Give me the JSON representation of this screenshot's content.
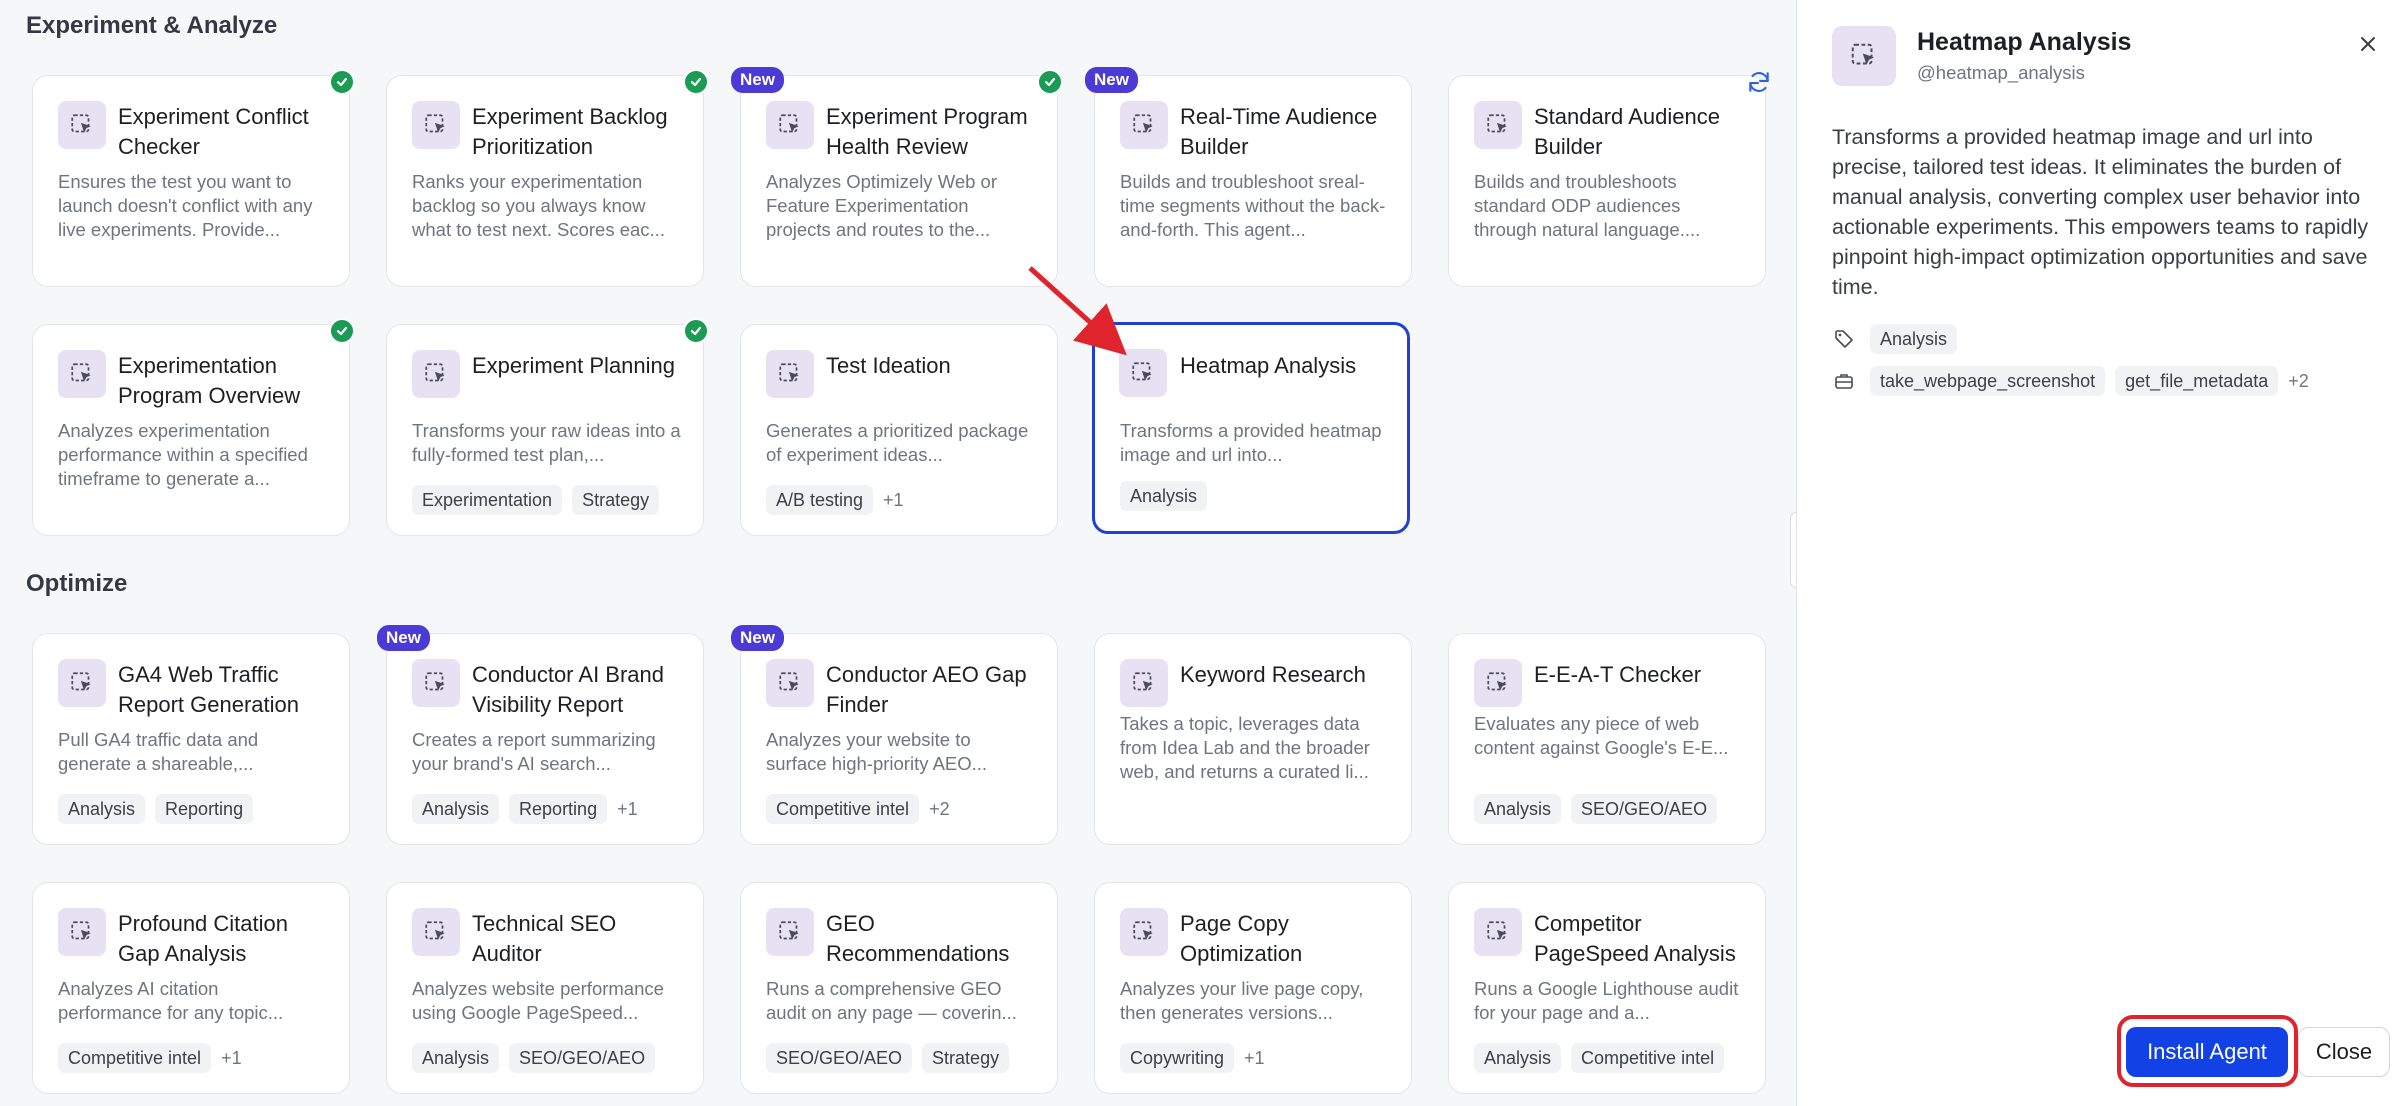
{
  "sections": {
    "experiment": "Experiment & Analyze",
    "optimize": "Optimize"
  },
  "cards": {
    "conflict": {
      "title": "Experiment Conflict Checker",
      "desc": "Ensures the test you want to launch doesn't conflict with any live experiments. Provide...",
      "badge": "check"
    },
    "backlog": {
      "title": "Experiment Backlog Prioritization",
      "desc": "Ranks your experimentation backlog so you always know what to test next. Scores eac...",
      "badge": "check"
    },
    "health": {
      "title": "Experiment Program Health Review",
      "desc": "Analyzes Optimizely Web or Feature Experimentation projects and routes to the...",
      "badge_new": "New",
      "badge": "check"
    },
    "realtime": {
      "title": "Real-Time Audience Builder",
      "desc": "Builds and troubleshoot sreal-time segments without the back-and-forth. This agent...",
      "badge_new": "New"
    },
    "standard": {
      "title": "Standard Audience Builder",
      "desc": "Builds and troubleshoots standard ODP audiences through natural language....",
      "badge": "refresh"
    },
    "overview": {
      "title": "Experimentation Program Overview",
      "desc": "Analyzes experimentation performance within a specified timeframe to generate a...",
      "badge": "check"
    },
    "planning": {
      "title": "Experiment Planning",
      "desc": "Transforms your raw ideas into a fully-formed test plan,...",
      "tags": [
        "Experimentation",
        "Strategy"
      ],
      "badge": "check"
    },
    "ideation": {
      "title": "Test Ideation",
      "desc": "Generates a prioritized package of experiment ideas...",
      "tags": [
        "A/B testing"
      ],
      "more": "+1"
    },
    "heatmap": {
      "title": "Heatmap Analysis",
      "desc": "Transforms a provided heatmap image and url into...",
      "tags": [
        "Analysis"
      ]
    },
    "ga4": {
      "title": "GA4 Web Traffic Report Generation",
      "desc": "Pull GA4 traffic data and generate a shareable,...",
      "tags": [
        "Analysis",
        "Reporting"
      ]
    },
    "brand": {
      "title": "Conductor AI Brand Visibility Report",
      "desc": "Creates a report summarizing your brand's AI search...",
      "tags": [
        "Analysis",
        "Reporting"
      ],
      "more": "+1",
      "badge_new": "New"
    },
    "aeo": {
      "title": "Conductor AEO Gap Finder",
      "desc": "Analyzes your website to surface high-priority AEO...",
      "tags": [
        "Competitive intel"
      ],
      "more": "+2",
      "badge_new": "New"
    },
    "keyword": {
      "title": "Keyword Research",
      "desc": "Takes a topic, leverages data from Idea Lab and the broader web, and returns a curated li..."
    },
    "eeat": {
      "title": "E-E-A-T Checker",
      "desc": "Evaluates any piece of web content against Google's E-E...",
      "tags": [
        "Analysis",
        "SEO/GEO/AEO"
      ]
    },
    "citation": {
      "title": "Profound Citation Gap Analysis",
      "desc": "Analyzes AI citation performance for any topic...",
      "tags": [
        "Competitive intel"
      ],
      "more": "+1"
    },
    "seo": {
      "title": "Technical SEO Auditor",
      "desc": "Analyzes website performance using Google PageSpeed...",
      "tags": [
        "Analysis",
        "SEO/GEO/AEO"
      ]
    },
    "geo": {
      "title": "GEO Recommendations",
      "desc": "Runs a comprehensive GEO audit on any page — coverin...",
      "tags": [
        "SEO/GEO/AEO",
        "Strategy"
      ]
    },
    "copy": {
      "title": "Page Copy Optimization",
      "desc": "Analyzes your live page copy, then generates versions...",
      "tags": [
        "Copywriting"
      ],
      "more": "+1"
    },
    "pagespeed": {
      "title": "Competitor PageSpeed Analysis",
      "desc": "Runs a Google Lighthouse audit for your page and a...",
      "tags": [
        "Analysis",
        "Competitive intel"
      ]
    }
  },
  "details": {
    "title": "Heatmap Analysis",
    "handle": "@heatmap_analysis",
    "description": "Transforms a provided heatmap image and url into precise, tailored test ideas. It eliminates the burden of manual analysis, converting complex user behavior into actionable experiments. This empowers teams to rapidly pinpoint high-impact optimization opportunities and save time.",
    "category_tag": "Analysis",
    "tools": [
      "take_webpage_screenshot",
      "get_file_metadata"
    ],
    "tools_more": "+2",
    "install_label": "Install Agent",
    "close_label": "Close"
  },
  "colors": {
    "accent": "#1242e6",
    "selected_border": "#1f3fd6",
    "badge_new": "#4b3ad6",
    "check": "#1c9b55",
    "annotation": "#e0242e"
  },
  "icons": {
    "agent": "cursor-select-icon",
    "check": "check-icon",
    "refresh": "refresh-icon",
    "close": "close-icon",
    "tag": "tag-icon",
    "tools": "toolbox-icon"
  }
}
